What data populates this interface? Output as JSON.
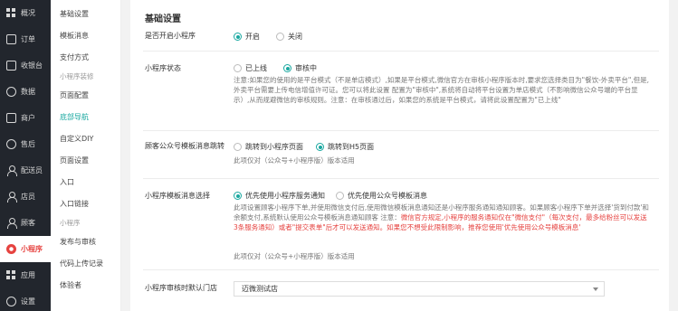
{
  "nav": {
    "items": [
      {
        "label": "概况",
        "icon": "grid-icon"
      },
      {
        "label": "订单",
        "icon": "order-icon"
      },
      {
        "label": "收银台",
        "icon": "cashier-icon"
      },
      {
        "label": "数据",
        "icon": "chart-icon"
      },
      {
        "label": "商户",
        "icon": "store-icon"
      },
      {
        "label": "售后",
        "icon": "service-icon"
      },
      {
        "label": "配送员",
        "icon": "courier-icon"
      },
      {
        "label": "店员",
        "icon": "staff-icon"
      },
      {
        "label": "顾客",
        "icon": "customer-icon"
      },
      {
        "label": "小程序",
        "icon": "miniprogram-icon",
        "active": true
      },
      {
        "label": "应用",
        "icon": "apps-icon"
      },
      {
        "label": "设置",
        "icon": "settings-icon"
      }
    ],
    "active_color": "#e64340"
  },
  "subnav": {
    "items": [
      {
        "type": "item",
        "label": "基础设置"
      },
      {
        "type": "item",
        "label": "模板消息"
      },
      {
        "type": "item",
        "label": "支付方式"
      },
      {
        "type": "group",
        "label": "小程序装修"
      },
      {
        "type": "item",
        "label": "页面配置"
      },
      {
        "type": "item",
        "label": "底部导航",
        "active": true
      },
      {
        "type": "item",
        "label": "自定义DIY"
      },
      {
        "type": "item",
        "label": "页面设置"
      },
      {
        "type": "item",
        "label": "入口"
      },
      {
        "type": "item",
        "label": "入口链接"
      },
      {
        "type": "group",
        "label": "小程序"
      },
      {
        "type": "item",
        "label": "发布与审核"
      },
      {
        "type": "item",
        "label": "代码上传记录"
      },
      {
        "type": "item",
        "label": "体验者"
      }
    ],
    "active_color": "#19a8a0"
  },
  "main": {
    "title": "基础设置",
    "enable": {
      "label": "是否开启小程序",
      "options": [
        "开启",
        "关闭"
      ],
      "selected": 0
    },
    "status": {
      "label": "小程序状态",
      "options": [
        "已上线",
        "审核中"
      ],
      "selected": 1,
      "note": "注意:如果您的使用的是平台模式（不是单店模式）,如果是平台模式,微信官方在审核小程序版本时,要求您选择类目为\"餐饮-外卖平台\",但是,外卖平台需要上传电信增值许可证。您可以将此设置 配置为\"审核中\",系统将自动将平台设置为单店模式（不影响微信公众号端的平台显示）,从而规避微信的审核规则。注意：在审核通过后，如果您的系统是平台模式，请将此设置配置为\"已上线\""
    },
    "template_jump": {
      "label": "顾客公众号模板消息跳转",
      "options": [
        "跳转到小程序页面",
        "跳转到H5页面"
      ],
      "selected": 1,
      "note": "此项仅对（公众号+小程序版）版本适用"
    },
    "template_priority": {
      "label": "小程序模板消息选择",
      "options": [
        "优先使用小程序服务通知",
        "优先使用公众号模板消息"
      ],
      "selected": 0,
      "note_a": "此项设置顾客小程序下单,并使用微信支付后,使用微信模板消息通知还是小程序服务通知通知顾客。如果顾客小程序下单并选择'货到付款'和余额支付,系统默认使用公众号模板消息通知顾客 注意：",
      "note_red": "微信官方规定,小程序的服务通知仅在\"微信支付\"（每次支付，最多给粉丝可以发送3条服务通知）或者\"提交表单\"后才可以发送通知。如果您不想受此限制影响，推荐您使用'优先使用公众号模板消息'",
      "note2": "此项仅对（公众号+小程序版）版本适用"
    },
    "review_store": {
      "label": "小程序审核时默认门店",
      "value": "迈微测试店"
    }
  },
  "colors": {
    "accent": "#19a8a0",
    "danger": "#e64340",
    "nav_bg": "#22262d"
  }
}
